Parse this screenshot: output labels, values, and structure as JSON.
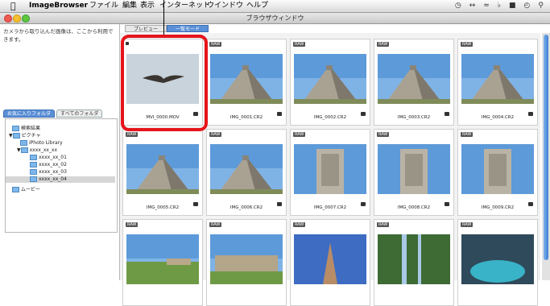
{
  "menubar": {
    "app_name": "ImageBrowser",
    "items": [
      "ファイル",
      "編集",
      "表示",
      "インターネット",
      "ウインドウ",
      "ヘルプ"
    ]
  },
  "window": {
    "title": "ブラウザウィンドウ"
  },
  "left_pane": {
    "note": "カメラから取り込んだ画像は、ここから利用できます。",
    "tabs": [
      "お気に入りフォルダ",
      "すべてのフォルダ"
    ],
    "tree": [
      {
        "label": "検索結果"
      },
      {
        "label": "ピクチャ"
      },
      {
        "label": "iPhoto Library"
      },
      {
        "label": "xxxx_xx_xx"
      },
      {
        "label": "xxxx_xx_01"
      },
      {
        "label": "xxxx_xx_02"
      },
      {
        "label": "xxxx_xx_03"
      },
      {
        "label": "xxxx_xx_04"
      },
      {
        "label": "ムービー"
      }
    ]
  },
  "view_tabs": [
    "プレビュー",
    "一覧モード"
  ],
  "thumbnails": [
    {
      "label": "MVI_0000.MOV",
      "badge": "",
      "type": "bird"
    },
    {
      "label": "IMG_0001.CR2",
      "badge": "RAW",
      "type": "pyramid"
    },
    {
      "label": "IMG_0002.CR2",
      "badge": "RAW",
      "type": "pyramid"
    },
    {
      "label": "IMG_0003.CR2",
      "badge": "RAW",
      "type": "pyramid"
    },
    {
      "label": "IMG_0004.CR2",
      "badge": "RAW",
      "type": "pyramid"
    },
    {
      "label": "IMG_0005.CR2",
      "badge": "RAW",
      "type": "pyramid"
    },
    {
      "label": "IMG_0006.CR2",
      "badge": "RAW",
      "type": "pyramid"
    },
    {
      "label": "IMG_0007.CR2",
      "badge": "RAW",
      "type": "tower"
    },
    {
      "label": "IMG_0008.CR2",
      "badge": "RAW",
      "type": "tower"
    },
    {
      "label": "IMG_0009.CR2",
      "badge": "RAW",
      "type": "tower"
    },
    {
      "label": "",
      "badge": "RAW",
      "type": "field"
    },
    {
      "label": "",
      "badge": "RAW",
      "type": "ruin"
    },
    {
      "label": "",
      "badge": "RAW",
      "type": "spire"
    },
    {
      "label": "",
      "badge": "RAW",
      "type": "cenote"
    },
    {
      "label": "",
      "badge": "RAW",
      "type": "cave"
    }
  ],
  "colors": {
    "highlight": "#e6141b",
    "accent": "#5b8fd6"
  }
}
